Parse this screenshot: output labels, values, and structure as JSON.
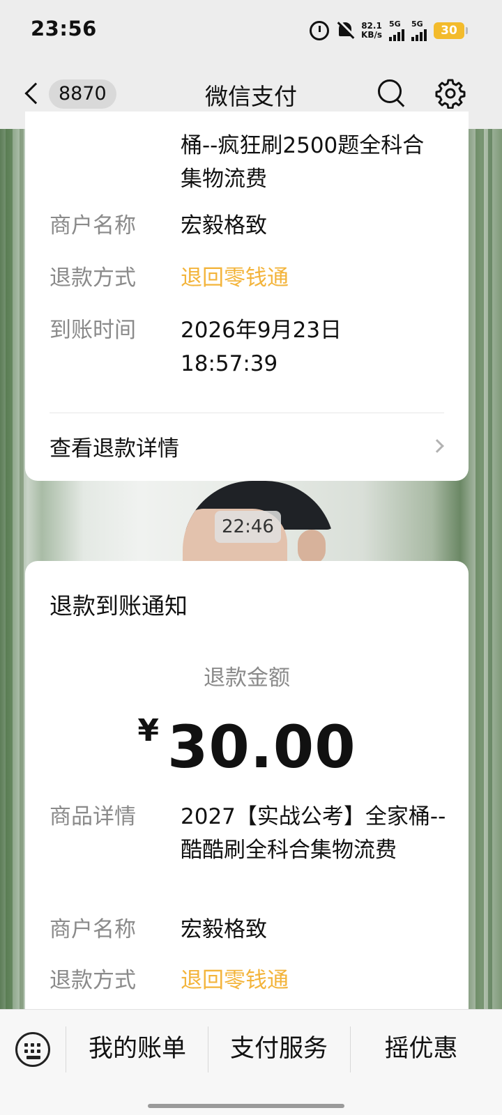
{
  "status_bar": {
    "time": "23:56",
    "net_speed_value": "82.1",
    "net_speed_unit": "KB/s",
    "sim1": "5G",
    "sim2": "5G",
    "battery": "30",
    "icons": [
      "alarm-icon",
      "mute-bell-icon",
      "signal-icon",
      "battery-icon"
    ]
  },
  "nav": {
    "unread_badge": "8870",
    "title": "微信支付"
  },
  "card_top": {
    "goods_continuation": "桶--疯狂刷2500题全科合集物流费",
    "rows": [
      {
        "label": "商户名称",
        "value": "宏毅格致"
      },
      {
        "label": "退款方式",
        "value": "退回零钱通"
      },
      {
        "label": "到账时间",
        "value": "2026年9月23日 18:57:39"
      }
    ],
    "detail_link": "查看退款详情"
  },
  "timestamp": "22:46",
  "card_bottom": {
    "title": "退款到账通知",
    "amount_label": "退款金额",
    "currency": "¥",
    "amount": "30.00",
    "rows": [
      {
        "label": "商品详情",
        "value": "2027【实战公考】全家桶--酷酷刷全科合集物流费"
      },
      {
        "label": "商户名称",
        "value": "宏毅格致"
      },
      {
        "label": "退款方式",
        "value": "退回零钱通"
      }
    ]
  },
  "bottom_bar": {
    "tabs": [
      "我的账单",
      "支付服务",
      "摇优惠"
    ]
  },
  "colors": {
    "accent_orange": "#f3b43b",
    "battery_yellow": "#f3bb2c",
    "bar_gray": "#ededed"
  }
}
